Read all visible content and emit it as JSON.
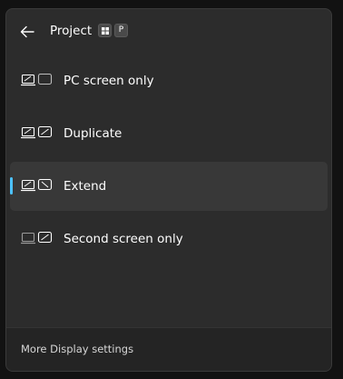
{
  "flyout": {
    "title": "Project",
    "shortcut_keys": [
      "windows-logo",
      "P"
    ],
    "accent_color": "#4cc2ff",
    "options": [
      {
        "label": "PC screen only",
        "icon": "pc-screen-only-icon",
        "selected": false
      },
      {
        "label": "Duplicate",
        "icon": "duplicate-icon",
        "selected": false
      },
      {
        "label": "Extend",
        "icon": "extend-icon",
        "selected": true
      },
      {
        "label": "Second screen only",
        "icon": "second-screen-only-icon",
        "selected": false
      }
    ],
    "footer_link": "More Display settings"
  }
}
